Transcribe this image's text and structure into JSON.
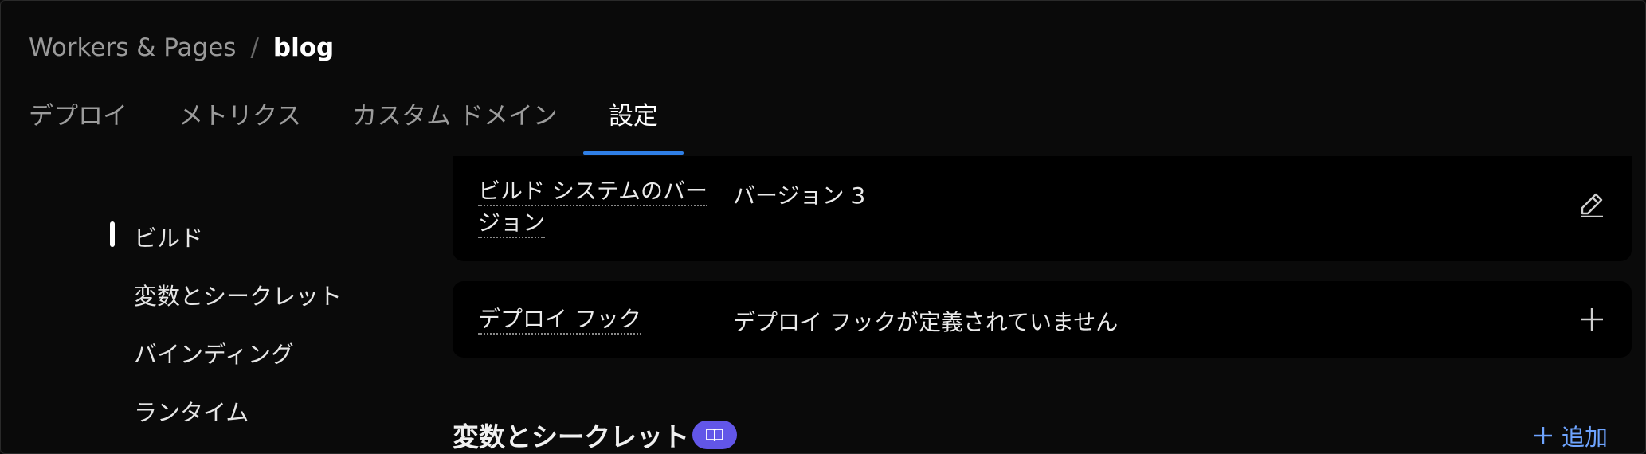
{
  "breadcrumb": {
    "parent": "Workers & Pages",
    "separator": "/",
    "current": "blog"
  },
  "tabs": [
    {
      "label": "デプロイ",
      "active": false
    },
    {
      "label": "メトリクス",
      "active": false
    },
    {
      "label": "カスタム ドメイン",
      "active": false
    },
    {
      "label": "設定",
      "active": true
    }
  ],
  "side_nav": {
    "items": [
      {
        "label": "ビルド",
        "active": true
      },
      {
        "label": "変数とシークレット",
        "active": false
      },
      {
        "label": "バインディング",
        "active": false
      },
      {
        "label": "ランタイム",
        "active": false
      }
    ]
  },
  "build_system_version": {
    "label_line1": "ビルド システムのバー",
    "label_line2": "ジョン",
    "value": "バージョン 3",
    "action_icon": "pencil-icon"
  },
  "deploy_hooks": {
    "label": "デプロイ フック",
    "value": "デプロイ フックが定義されていません",
    "action_icon": "plus-icon"
  },
  "variables_section": {
    "title": "変数とシークレット",
    "badge_icon": "book-icon",
    "add_label": "追加"
  },
  "colors": {
    "accent": "#2f7fe6",
    "badge": "#6256e8",
    "link": "#6ea4ff"
  }
}
